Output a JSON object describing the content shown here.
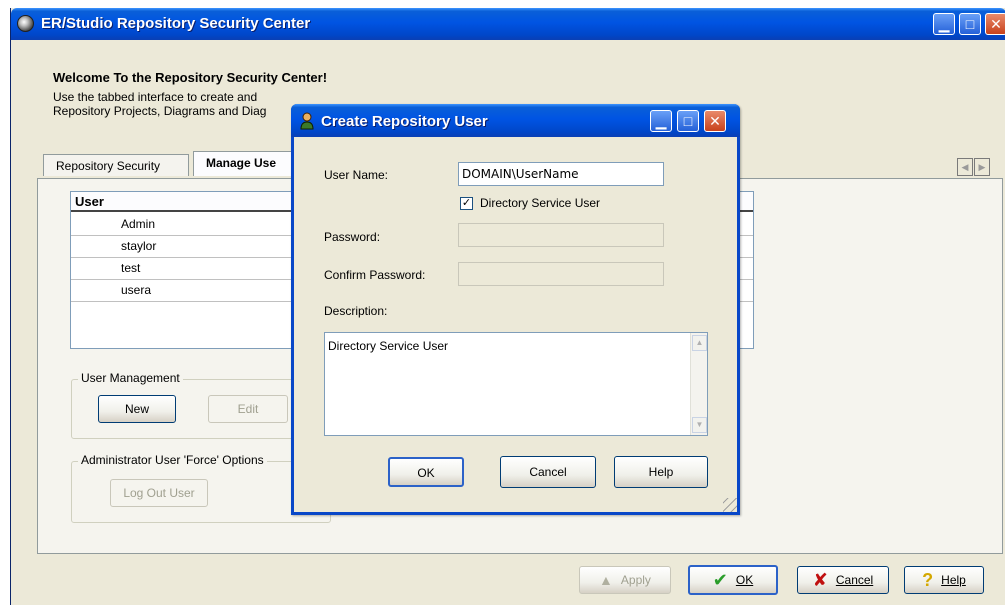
{
  "main_window": {
    "title": "ER/Studio Repository Security Center",
    "welcome_title": "Welcome To the Repository Security Center!",
    "welcome_desc_line1": "Use the tabbed interface to create and",
    "welcome_desc_line2": "Repository Projects, Diagrams and Diag",
    "tabs": [
      {
        "label": "Repository Security",
        "active": false
      },
      {
        "label": "Manage Use",
        "active": true
      }
    ],
    "user_list": {
      "header": "User",
      "rows": [
        "Admin",
        "staylor",
        "test",
        "usera"
      ]
    },
    "user_management": {
      "group_label": "User Management",
      "new_label": "New",
      "edit_label": "Edit"
    },
    "force_options": {
      "group_label": "Administrator User 'Force' Options",
      "logout_label": "Log Out User"
    },
    "bottom_buttons": {
      "apply": "Apply",
      "ok": "OK",
      "cancel": "Cancel",
      "help": "Help"
    }
  },
  "dialog": {
    "title": "Create Repository User",
    "user_name_label": "User Name:",
    "user_name_value": "DOMAIN\\UserName",
    "directory_service_label": "Directory Service User",
    "directory_service_checked": true,
    "password_label": "Password:",
    "confirm_password_label": "Confirm Password:",
    "description_label": "Description:",
    "description_value": "Directory Service User",
    "ok_label": "OK",
    "cancel_label": "Cancel",
    "help_label": "Help"
  },
  "colors": {
    "titlebar_blue": "#0054e3",
    "window_bg": "#ece9d8",
    "ok_check_green": "#2a9d2a",
    "cancel_x_red": "#c01010"
  }
}
